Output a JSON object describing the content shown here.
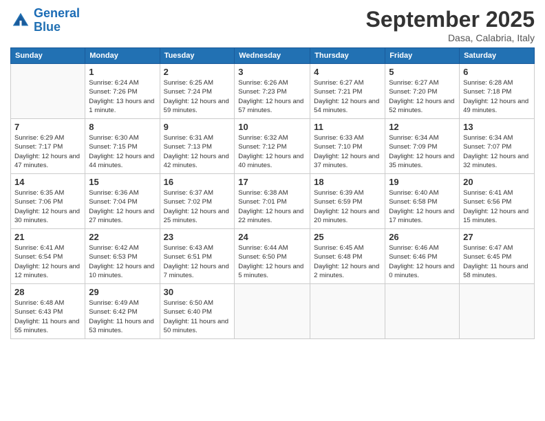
{
  "header": {
    "logo_line1": "General",
    "logo_line2": "Blue",
    "month": "September 2025",
    "location": "Dasa, Calabria, Italy"
  },
  "weekdays": [
    "Sunday",
    "Monday",
    "Tuesday",
    "Wednesday",
    "Thursday",
    "Friday",
    "Saturday"
  ],
  "weeks": [
    [
      {
        "day": "",
        "info": ""
      },
      {
        "day": "1",
        "info": "Sunrise: 6:24 AM\nSunset: 7:26 PM\nDaylight: 13 hours\nand 1 minute."
      },
      {
        "day": "2",
        "info": "Sunrise: 6:25 AM\nSunset: 7:24 PM\nDaylight: 12 hours\nand 59 minutes."
      },
      {
        "day": "3",
        "info": "Sunrise: 6:26 AM\nSunset: 7:23 PM\nDaylight: 12 hours\nand 57 minutes."
      },
      {
        "day": "4",
        "info": "Sunrise: 6:27 AM\nSunset: 7:21 PM\nDaylight: 12 hours\nand 54 minutes."
      },
      {
        "day": "5",
        "info": "Sunrise: 6:27 AM\nSunset: 7:20 PM\nDaylight: 12 hours\nand 52 minutes."
      },
      {
        "day": "6",
        "info": "Sunrise: 6:28 AM\nSunset: 7:18 PM\nDaylight: 12 hours\nand 49 minutes."
      }
    ],
    [
      {
        "day": "7",
        "info": "Sunrise: 6:29 AM\nSunset: 7:17 PM\nDaylight: 12 hours\nand 47 minutes."
      },
      {
        "day": "8",
        "info": "Sunrise: 6:30 AM\nSunset: 7:15 PM\nDaylight: 12 hours\nand 44 minutes."
      },
      {
        "day": "9",
        "info": "Sunrise: 6:31 AM\nSunset: 7:13 PM\nDaylight: 12 hours\nand 42 minutes."
      },
      {
        "day": "10",
        "info": "Sunrise: 6:32 AM\nSunset: 7:12 PM\nDaylight: 12 hours\nand 40 minutes."
      },
      {
        "day": "11",
        "info": "Sunrise: 6:33 AM\nSunset: 7:10 PM\nDaylight: 12 hours\nand 37 minutes."
      },
      {
        "day": "12",
        "info": "Sunrise: 6:34 AM\nSunset: 7:09 PM\nDaylight: 12 hours\nand 35 minutes."
      },
      {
        "day": "13",
        "info": "Sunrise: 6:34 AM\nSunset: 7:07 PM\nDaylight: 12 hours\nand 32 minutes."
      }
    ],
    [
      {
        "day": "14",
        "info": "Sunrise: 6:35 AM\nSunset: 7:06 PM\nDaylight: 12 hours\nand 30 minutes."
      },
      {
        "day": "15",
        "info": "Sunrise: 6:36 AM\nSunset: 7:04 PM\nDaylight: 12 hours\nand 27 minutes."
      },
      {
        "day": "16",
        "info": "Sunrise: 6:37 AM\nSunset: 7:02 PM\nDaylight: 12 hours\nand 25 minutes."
      },
      {
        "day": "17",
        "info": "Sunrise: 6:38 AM\nSunset: 7:01 PM\nDaylight: 12 hours\nand 22 minutes."
      },
      {
        "day": "18",
        "info": "Sunrise: 6:39 AM\nSunset: 6:59 PM\nDaylight: 12 hours\nand 20 minutes."
      },
      {
        "day": "19",
        "info": "Sunrise: 6:40 AM\nSunset: 6:58 PM\nDaylight: 12 hours\nand 17 minutes."
      },
      {
        "day": "20",
        "info": "Sunrise: 6:41 AM\nSunset: 6:56 PM\nDaylight: 12 hours\nand 15 minutes."
      }
    ],
    [
      {
        "day": "21",
        "info": "Sunrise: 6:41 AM\nSunset: 6:54 PM\nDaylight: 12 hours\nand 12 minutes."
      },
      {
        "day": "22",
        "info": "Sunrise: 6:42 AM\nSunset: 6:53 PM\nDaylight: 12 hours\nand 10 minutes."
      },
      {
        "day": "23",
        "info": "Sunrise: 6:43 AM\nSunset: 6:51 PM\nDaylight: 12 hours\nand 7 minutes."
      },
      {
        "day": "24",
        "info": "Sunrise: 6:44 AM\nSunset: 6:50 PM\nDaylight: 12 hours\nand 5 minutes."
      },
      {
        "day": "25",
        "info": "Sunrise: 6:45 AM\nSunset: 6:48 PM\nDaylight: 12 hours\nand 2 minutes."
      },
      {
        "day": "26",
        "info": "Sunrise: 6:46 AM\nSunset: 6:46 PM\nDaylight: 12 hours\nand 0 minutes."
      },
      {
        "day": "27",
        "info": "Sunrise: 6:47 AM\nSunset: 6:45 PM\nDaylight: 11 hours\nand 58 minutes."
      }
    ],
    [
      {
        "day": "28",
        "info": "Sunrise: 6:48 AM\nSunset: 6:43 PM\nDaylight: 11 hours\nand 55 minutes."
      },
      {
        "day": "29",
        "info": "Sunrise: 6:49 AM\nSunset: 6:42 PM\nDaylight: 11 hours\nand 53 minutes."
      },
      {
        "day": "30",
        "info": "Sunrise: 6:50 AM\nSunset: 6:40 PM\nDaylight: 11 hours\nand 50 minutes."
      },
      {
        "day": "",
        "info": ""
      },
      {
        "day": "",
        "info": ""
      },
      {
        "day": "",
        "info": ""
      },
      {
        "day": "",
        "info": ""
      }
    ]
  ]
}
